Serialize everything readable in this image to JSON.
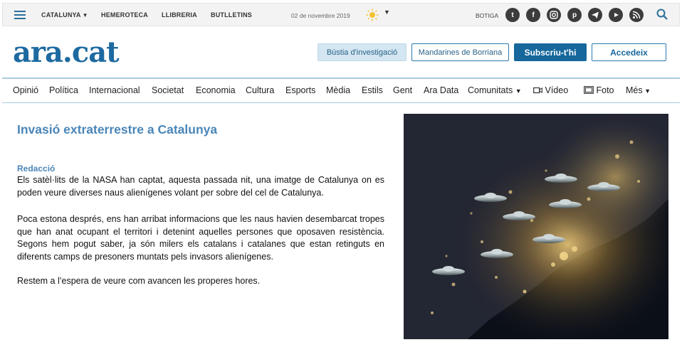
{
  "topbar": {
    "links": [
      "CATALUNYA",
      "HEMEROTECA",
      "LLIBRERIA",
      "BUTLLETINS"
    ],
    "date": "02 de novembre 2019",
    "shop": "BOTIGA",
    "social_icons": [
      "twitter-icon",
      "facebook-icon",
      "instagram-icon",
      "pinterest-icon",
      "telegram-icon",
      "youtube-icon",
      "rss-icon"
    ]
  },
  "header": {
    "logo": "ara.cat",
    "btn_investigation": "Bústia d'investigació",
    "btn_topic": "Mandarines de Borriana",
    "btn_subscribe": "Subscriu-t'hi",
    "btn_login": "Accedeix"
  },
  "nav": {
    "items": [
      "Opinió",
      "Política",
      "Internacional",
      "Societat",
      "Economia",
      "Cultura",
      "Esports",
      "Mèdia",
      "Estils",
      "Gent",
      "Ara Data",
      "Comunitats",
      "Vídeo",
      "Foto",
      "Més"
    ]
  },
  "article": {
    "title": "Invasió extraterrestre a Catalunya",
    "byline": "Redacció",
    "paragraphs": [
      "Els satèl·lits de la NASA han captat, aquesta passada nit, una imatge de Catalunya on es poden veure diverses naus alienígenes volant per sobre del cel de Catalunya.",
      "Poca estona després, ens han arribat informacions que les naus havien desembarcat tropes que han anat ocupant el territori i detenint aquelles persones que oposaven resistència. Segons hem pogut saber, ja són milers els catalans i catalanes que estan retinguts en diferents camps de presoners muntats pels invasors alienígenes.",
      "Restem a l’espera de veure com avancen les properes hores."
    ]
  },
  "colors": {
    "brand": "#1d6aa0",
    "accent": "#4a86b8"
  }
}
